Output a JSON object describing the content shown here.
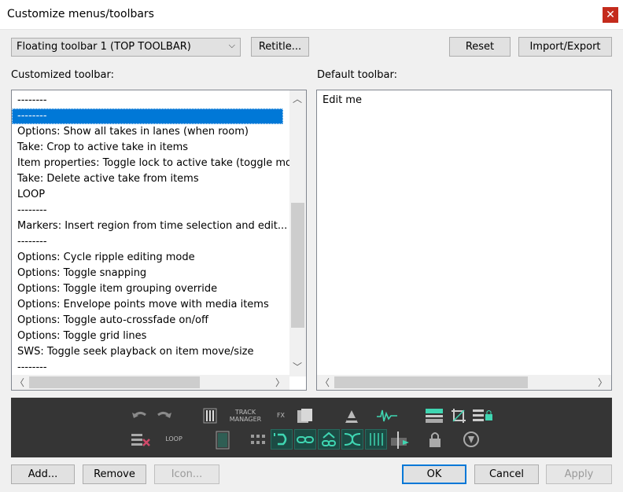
{
  "window": {
    "title": "Customize menus/toolbars",
    "close_label": "✕"
  },
  "toolbar_select": {
    "value": "Floating toolbar 1 (TOP TOOLBAR)"
  },
  "buttons": {
    "retitle": "Retitle...",
    "reset": "Reset",
    "import_export": "Import/Export",
    "add": "Add...",
    "remove": "Remove",
    "icon": "Icon...",
    "ok": "OK",
    "cancel": "Cancel",
    "apply": "Apply"
  },
  "customized": {
    "label": "Customized toolbar:",
    "items": [
      "--------",
      "--------",
      "Options: Show all takes in lanes (when room)",
      "Take: Crop to active take in items",
      "Item properties: Toggle lock to active take (toggle mouse click lock)",
      "Take: Delete active take from items",
      "LOOP",
      "--------",
      "Markers: Insert region from time selection and edit...",
      "--------",
      "Options: Cycle ripple editing mode",
      "Options: Toggle snapping",
      "Options: Toggle item grouping override",
      "Options: Envelope points move with media items",
      "Options: Toggle auto-crossfade on/off",
      "Options: Toggle grid lines",
      "SWS: Toggle seek playback on item move/size",
      "--------"
    ],
    "selected_index": 1
  },
  "default": {
    "label": "Default toolbar:",
    "items": [
      "Edit me"
    ]
  },
  "preview": {
    "track_manager_label": "TRACK\nMANAGER",
    "fx_label": "FX",
    "loop_label": "LOOP",
    "icons": [
      "undo-icon",
      "redo-icon",
      "mixer-icon",
      "folder-icon",
      "envelope-icon",
      "waveform-icon",
      "region-icon",
      "crop-icon",
      "lock-list-icon",
      "delete-item-icon",
      "notes-icon",
      "grid-icon",
      "ripple-icon",
      "link-icon",
      "group-icon",
      "crossfade-icon",
      "gridlines-icon",
      "seek-icon",
      "lock-icon",
      "pick-icon"
    ]
  }
}
